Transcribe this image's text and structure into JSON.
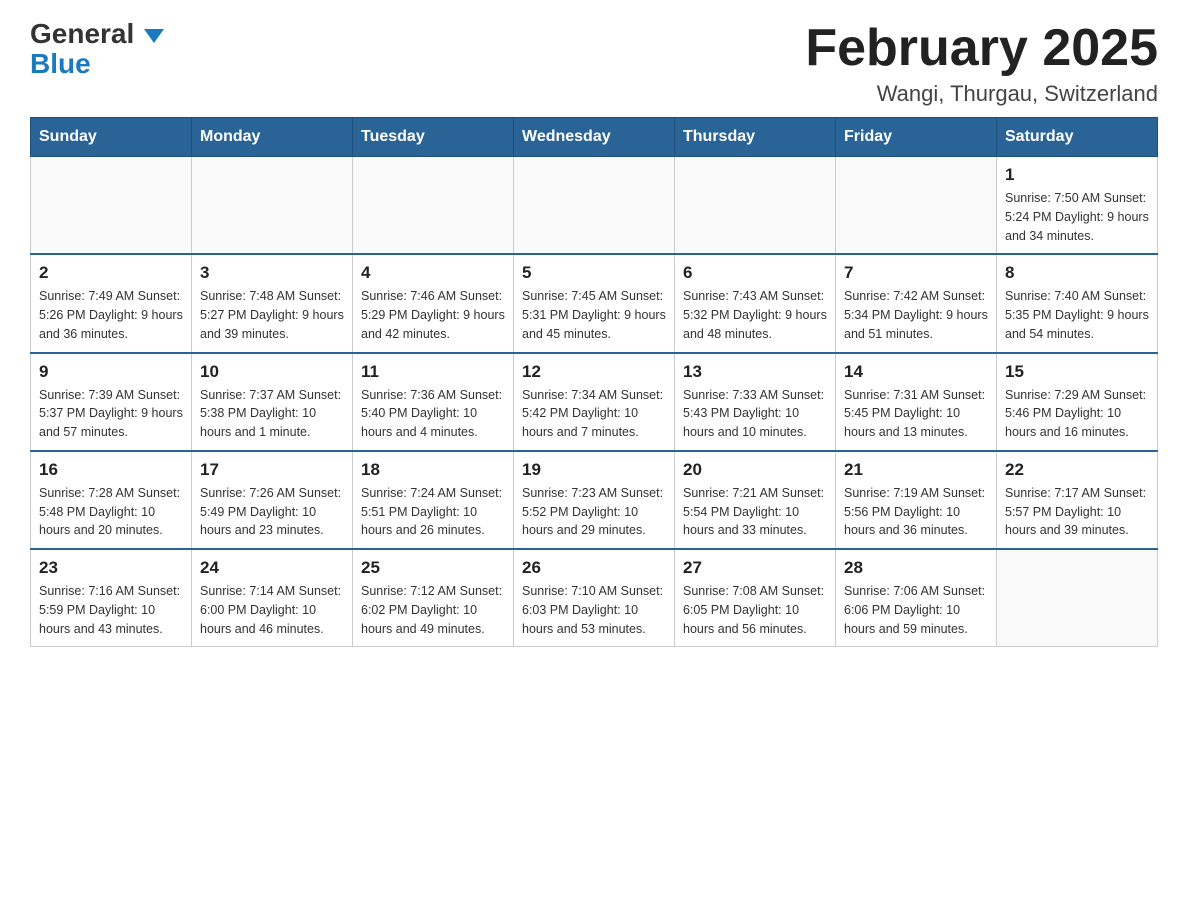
{
  "header": {
    "logo_general": "General",
    "logo_blue": "Blue",
    "month_title": "February 2025",
    "location": "Wangi, Thurgau, Switzerland"
  },
  "days_of_week": [
    "Sunday",
    "Monday",
    "Tuesday",
    "Wednesday",
    "Thursday",
    "Friday",
    "Saturday"
  ],
  "weeks": [
    [
      {
        "day": "",
        "info": ""
      },
      {
        "day": "",
        "info": ""
      },
      {
        "day": "",
        "info": ""
      },
      {
        "day": "",
        "info": ""
      },
      {
        "day": "",
        "info": ""
      },
      {
        "day": "",
        "info": ""
      },
      {
        "day": "1",
        "info": "Sunrise: 7:50 AM\nSunset: 5:24 PM\nDaylight: 9 hours and 34 minutes."
      }
    ],
    [
      {
        "day": "2",
        "info": "Sunrise: 7:49 AM\nSunset: 5:26 PM\nDaylight: 9 hours and 36 minutes."
      },
      {
        "day": "3",
        "info": "Sunrise: 7:48 AM\nSunset: 5:27 PM\nDaylight: 9 hours and 39 minutes."
      },
      {
        "day": "4",
        "info": "Sunrise: 7:46 AM\nSunset: 5:29 PM\nDaylight: 9 hours and 42 minutes."
      },
      {
        "day": "5",
        "info": "Sunrise: 7:45 AM\nSunset: 5:31 PM\nDaylight: 9 hours and 45 minutes."
      },
      {
        "day": "6",
        "info": "Sunrise: 7:43 AM\nSunset: 5:32 PM\nDaylight: 9 hours and 48 minutes."
      },
      {
        "day": "7",
        "info": "Sunrise: 7:42 AM\nSunset: 5:34 PM\nDaylight: 9 hours and 51 minutes."
      },
      {
        "day": "8",
        "info": "Sunrise: 7:40 AM\nSunset: 5:35 PM\nDaylight: 9 hours and 54 minutes."
      }
    ],
    [
      {
        "day": "9",
        "info": "Sunrise: 7:39 AM\nSunset: 5:37 PM\nDaylight: 9 hours and 57 minutes."
      },
      {
        "day": "10",
        "info": "Sunrise: 7:37 AM\nSunset: 5:38 PM\nDaylight: 10 hours and 1 minute."
      },
      {
        "day": "11",
        "info": "Sunrise: 7:36 AM\nSunset: 5:40 PM\nDaylight: 10 hours and 4 minutes."
      },
      {
        "day": "12",
        "info": "Sunrise: 7:34 AM\nSunset: 5:42 PM\nDaylight: 10 hours and 7 minutes."
      },
      {
        "day": "13",
        "info": "Sunrise: 7:33 AM\nSunset: 5:43 PM\nDaylight: 10 hours and 10 minutes."
      },
      {
        "day": "14",
        "info": "Sunrise: 7:31 AM\nSunset: 5:45 PM\nDaylight: 10 hours and 13 minutes."
      },
      {
        "day": "15",
        "info": "Sunrise: 7:29 AM\nSunset: 5:46 PM\nDaylight: 10 hours and 16 minutes."
      }
    ],
    [
      {
        "day": "16",
        "info": "Sunrise: 7:28 AM\nSunset: 5:48 PM\nDaylight: 10 hours and 20 minutes."
      },
      {
        "day": "17",
        "info": "Sunrise: 7:26 AM\nSunset: 5:49 PM\nDaylight: 10 hours and 23 minutes."
      },
      {
        "day": "18",
        "info": "Sunrise: 7:24 AM\nSunset: 5:51 PM\nDaylight: 10 hours and 26 minutes."
      },
      {
        "day": "19",
        "info": "Sunrise: 7:23 AM\nSunset: 5:52 PM\nDaylight: 10 hours and 29 minutes."
      },
      {
        "day": "20",
        "info": "Sunrise: 7:21 AM\nSunset: 5:54 PM\nDaylight: 10 hours and 33 minutes."
      },
      {
        "day": "21",
        "info": "Sunrise: 7:19 AM\nSunset: 5:56 PM\nDaylight: 10 hours and 36 minutes."
      },
      {
        "day": "22",
        "info": "Sunrise: 7:17 AM\nSunset: 5:57 PM\nDaylight: 10 hours and 39 minutes."
      }
    ],
    [
      {
        "day": "23",
        "info": "Sunrise: 7:16 AM\nSunset: 5:59 PM\nDaylight: 10 hours and 43 minutes."
      },
      {
        "day": "24",
        "info": "Sunrise: 7:14 AM\nSunset: 6:00 PM\nDaylight: 10 hours and 46 minutes."
      },
      {
        "day": "25",
        "info": "Sunrise: 7:12 AM\nSunset: 6:02 PM\nDaylight: 10 hours and 49 minutes."
      },
      {
        "day": "26",
        "info": "Sunrise: 7:10 AM\nSunset: 6:03 PM\nDaylight: 10 hours and 53 minutes."
      },
      {
        "day": "27",
        "info": "Sunrise: 7:08 AM\nSunset: 6:05 PM\nDaylight: 10 hours and 56 minutes."
      },
      {
        "day": "28",
        "info": "Sunrise: 7:06 AM\nSunset: 6:06 PM\nDaylight: 10 hours and 59 minutes."
      },
      {
        "day": "",
        "info": ""
      }
    ]
  ]
}
